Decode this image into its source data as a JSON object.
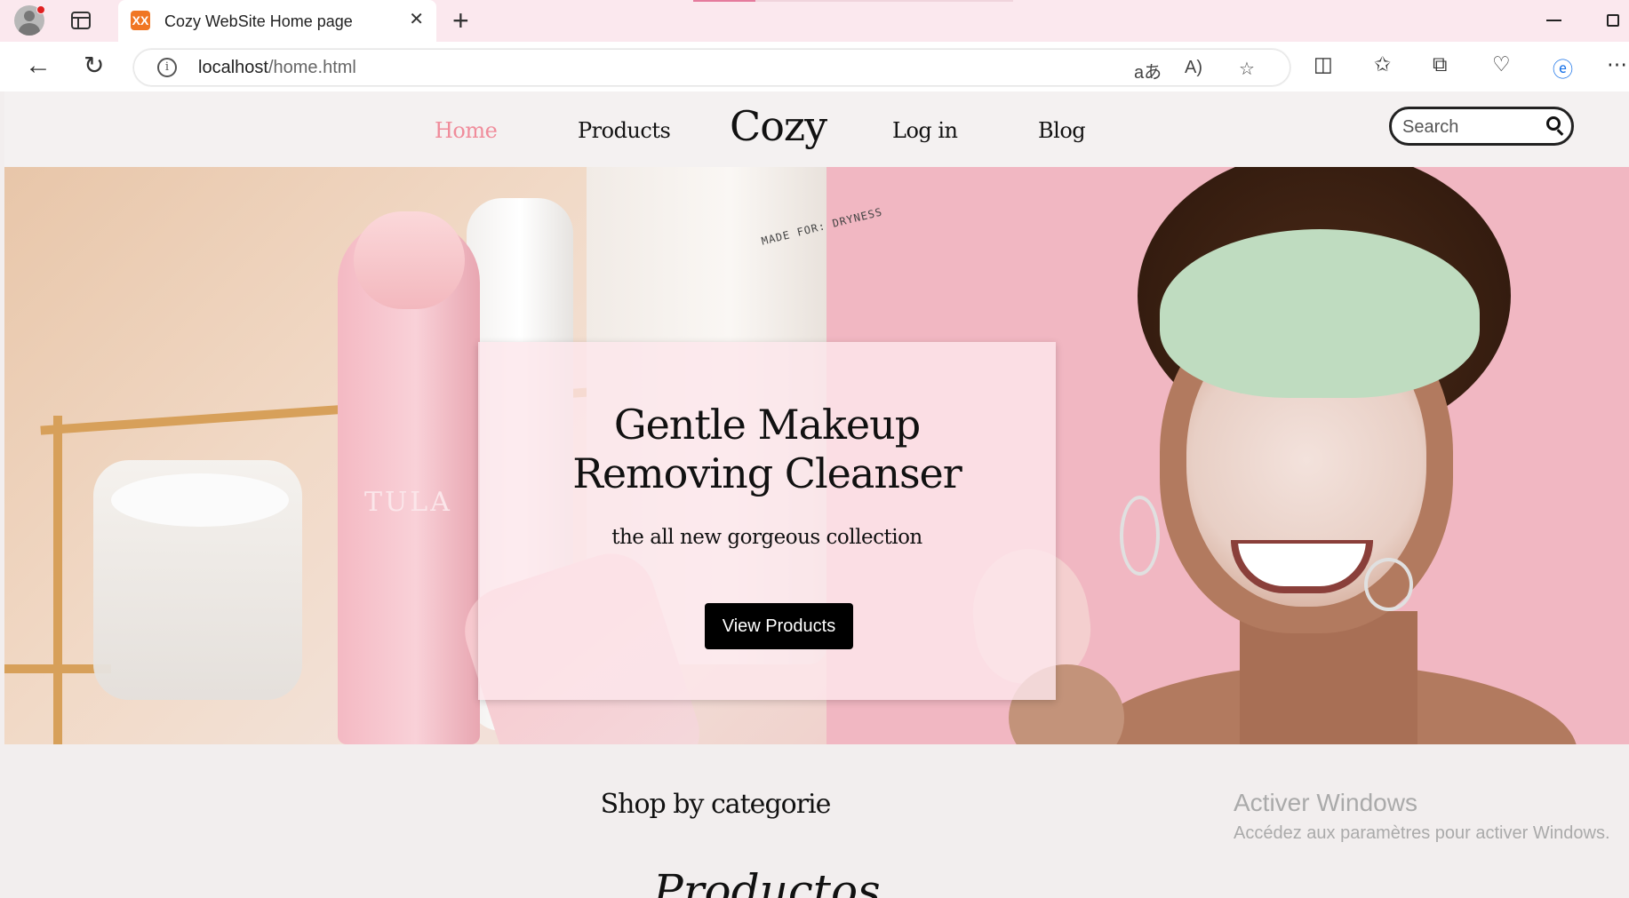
{
  "browser": {
    "tab_title": "Cozy WebSite Home page",
    "tab_favicon_text": "XX",
    "url_host": "localhost",
    "url_path": "/home.html"
  },
  "site": {
    "nav": {
      "home": "Home",
      "products": "Products",
      "logo": "Cozy",
      "login": "Log in",
      "blog": "Blog",
      "search_placeholder": "Search"
    },
    "hero": {
      "title_line1": "Gentle Makeup",
      "title_line2": "Removing Cleanser",
      "subtitle": "the all new gorgeous collection",
      "button": "View Products",
      "product_brand": "TULA",
      "bottle_text": "MADE FOR: DRYNESS"
    },
    "section_title": "Shop by categorie",
    "script_text": "Productos"
  },
  "windows": {
    "activate_title": "Activer Windows",
    "activate_sub": "Accédez aux paramètres pour activer Windows."
  },
  "colors": {
    "active_link": "#f08c9b",
    "hero_pink": "#f1b7c2",
    "button": "#000000"
  }
}
